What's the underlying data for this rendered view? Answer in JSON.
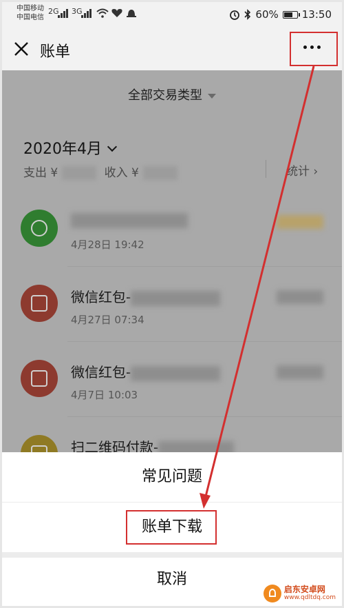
{
  "status_bar": {
    "carrier_1": "中国移动",
    "carrier_2": "中国电信",
    "signal_1": "2G",
    "signal_2": "3G",
    "battery": "60%",
    "time": "13:50"
  },
  "nav": {
    "title": "账单",
    "more_label": "更多"
  },
  "filter": {
    "label": "全部交易类型"
  },
  "month_summary": {
    "month": "2020年4月",
    "expense_label": "支出 ¥",
    "income_label": "收入 ¥",
    "stats_label": "统计 ›"
  },
  "transactions": [
    {
      "title": "",
      "time": "4月28日 19:42",
      "avatar": "wechat-pay-icon"
    },
    {
      "title": "微信红包-",
      "time": "4月27日 07:34",
      "avatar": "red-packet-icon"
    },
    {
      "title": "微信红包-",
      "time": "4月7日 10:03",
      "avatar": "red-packet-icon"
    },
    {
      "title": "扫二维码付款-",
      "time": "",
      "avatar": "qr-pay-icon"
    }
  ],
  "action_sheet": {
    "faq": "常见问题",
    "download": "账单下载",
    "cancel": "取消"
  },
  "watermark": {
    "name": "启东安卓网",
    "url": "www.qdltdq.com"
  },
  "colors": {
    "annotation_red": "#d32f2f",
    "overlay_gray": "#a9a9a9"
  }
}
